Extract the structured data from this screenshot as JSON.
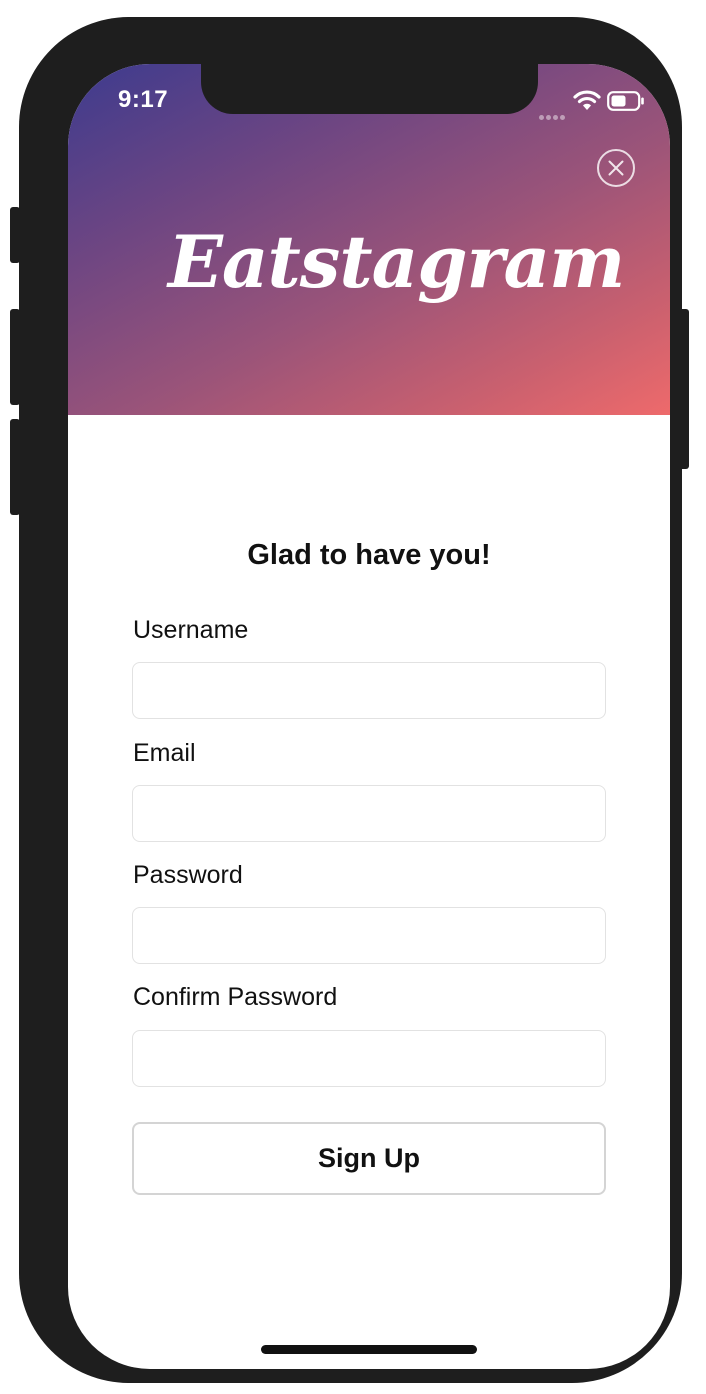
{
  "status_bar": {
    "time": "9:17",
    "wifi_icon": "wifi-icon",
    "battery_icon": "battery-icon"
  },
  "header": {
    "app_name": "Eatstagram",
    "close_icon": "close-icon",
    "gradient_colors": [
      "#3d3b8e",
      "#9b5479",
      "#ee6a6b"
    ]
  },
  "form": {
    "heading": "Glad to have you!",
    "fields": [
      {
        "label": "Username",
        "value": "",
        "placeholder": ""
      },
      {
        "label": "Email",
        "value": "",
        "placeholder": ""
      },
      {
        "label": "Password",
        "value": "",
        "placeholder": ""
      },
      {
        "label": "Confirm Password",
        "value": "",
        "placeholder": ""
      }
    ],
    "submit_label": "Sign Up"
  }
}
